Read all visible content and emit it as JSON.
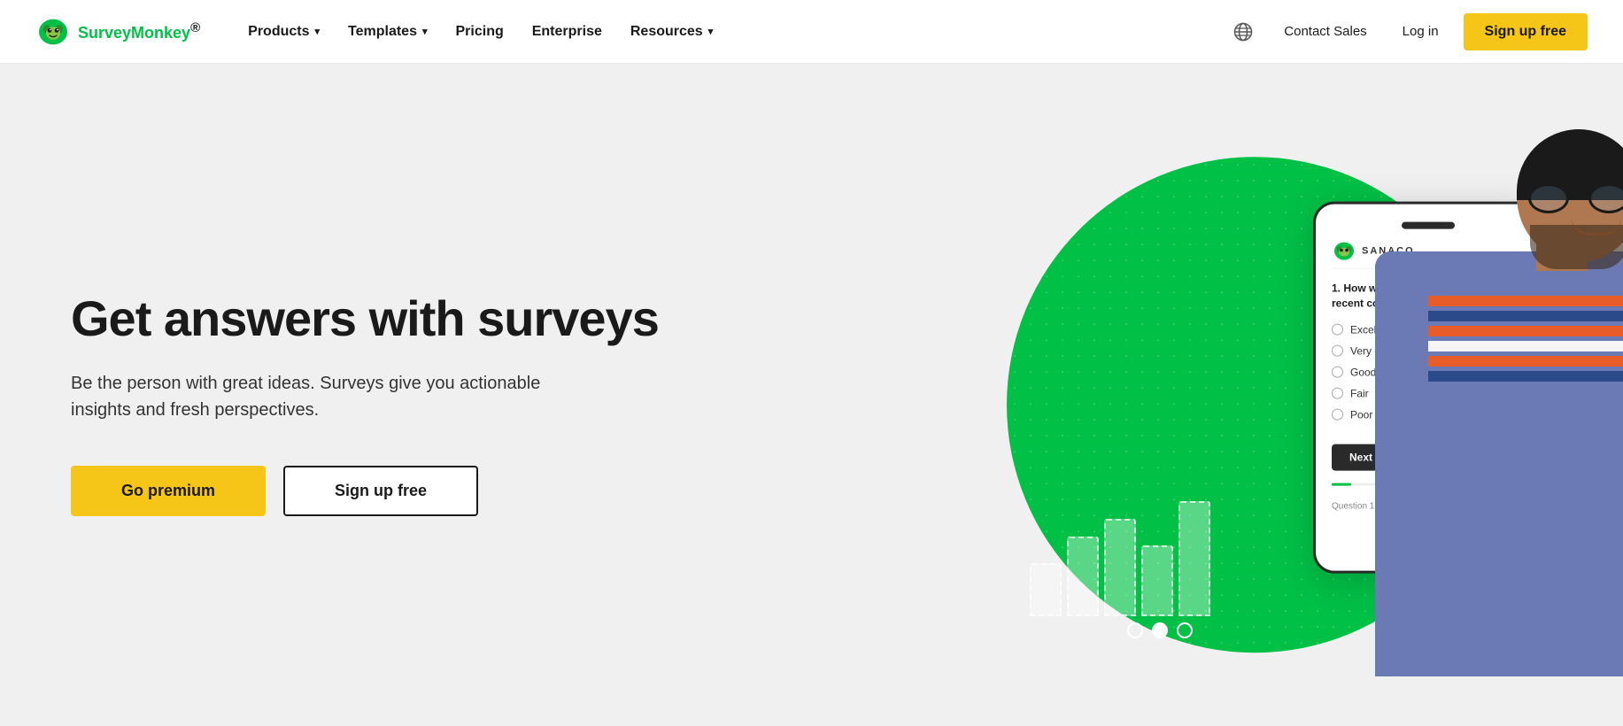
{
  "brand": {
    "name": "SurveyMonkey",
    "name_survey": "Survey",
    "name_monkey": "Monkey",
    "tagline": "®"
  },
  "navbar": {
    "products_label": "Products",
    "templates_label": "Templates",
    "pricing_label": "Pricing",
    "enterprise_label": "Enterprise",
    "resources_label": "Resources",
    "contact_sales_label": "Contact Sales",
    "login_label": "Log in",
    "signup_label": "Sign up free"
  },
  "hero": {
    "title": "Get answers with surveys",
    "subtitle": "Be the person with great ideas. Surveys give you actionable insights and fresh perspectives.",
    "cta_primary": "Go premium",
    "cta_secondary": "Sign up free"
  },
  "phone": {
    "brand": "SANACO",
    "question": "1. How would you rate our most recent company meeting?",
    "options": [
      "Excellent",
      "Very good",
      "Good",
      "Fair",
      "Poor"
    ],
    "next_btn": "Next",
    "progress_label": "Question 1 of 10"
  },
  "colors": {
    "green": "#00c046",
    "yellow": "#f5c518",
    "dark": "#1a1a1a",
    "white": "#ffffff"
  }
}
